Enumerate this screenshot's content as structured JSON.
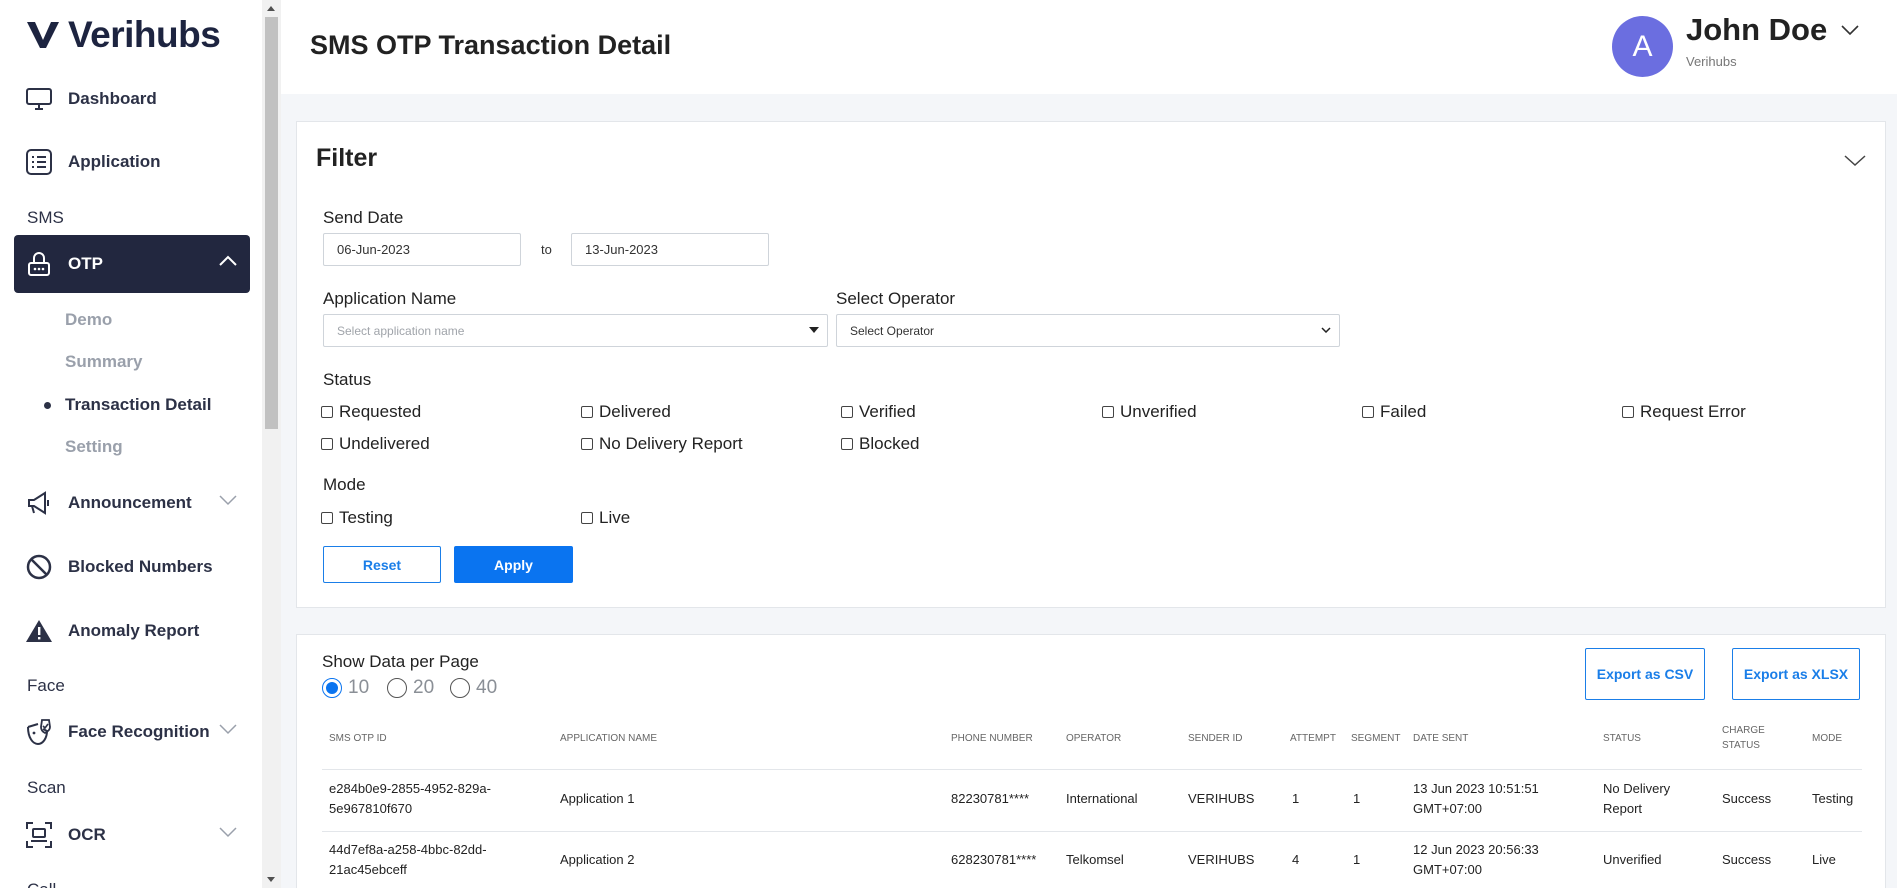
{
  "brand": {
    "name": "Verihubs",
    "accent": "#22273f",
    "primary": "#0a74f0"
  },
  "sidebar": {
    "dashboard": "Dashboard",
    "application": "Application",
    "sms_section": "SMS",
    "otp": "OTP",
    "otp_sub": [
      "Demo",
      "Summary",
      "Transaction Detail",
      "Setting"
    ],
    "announcement": "Announcement",
    "blocked_numbers": "Blocked Numbers",
    "anomaly_report": "Anomaly Report",
    "face_section": "Face",
    "face_recognition": "Face Recognition",
    "scan_section": "Scan",
    "ocr": "OCR",
    "next_section_partial": "Call"
  },
  "header": {
    "title": "SMS OTP Transaction Detail",
    "avatar_letter": "A",
    "user_name": "John Doe",
    "user_org": "Verihubs"
  },
  "filter": {
    "title": "Filter",
    "send_date_label": "Send Date",
    "date_from": "06-Jun-2023",
    "date_to_label": "to",
    "date_to": "13-Jun-2023",
    "app_name_label": "Application Name",
    "app_name_placeholder": "Select application name",
    "operator_label": "Select Operator",
    "operator_value": "Select Operator",
    "status_label": "Status",
    "statuses": [
      "Requested",
      "Delivered",
      "Verified",
      "Unverified",
      "Failed",
      "Request Error",
      "Undelivered",
      "No Delivery Report",
      "Blocked"
    ],
    "mode_label": "Mode",
    "modes": [
      "Testing",
      "Live"
    ],
    "reset": "Reset",
    "apply": "Apply"
  },
  "table": {
    "per_page_label": "Show Data per Page",
    "per_page_options": [
      "10",
      "20",
      "40"
    ],
    "per_page_selected": "10",
    "export_csv": "Export as CSV",
    "export_xlsx": "Export as XLSX",
    "headers": [
      "SMS OTP ID",
      "APPLICATION NAME",
      "PHONE NUMBER",
      "OPERATOR",
      "SENDER ID",
      "ATTEMPT",
      "SEGMENT",
      "DATE SENT",
      "STATUS",
      "CHARGE STATUS",
      "MODE"
    ],
    "rows": [
      {
        "id": "e284b0e9-2855-4952-829a-5e967810f670",
        "app": "Application 1",
        "phone": "82230781****",
        "operator": "International",
        "sender": "VERIHUBS",
        "attempt": "1",
        "segment": "1",
        "date": "13 Jun 2023 10:51:51 GMT+07:00",
        "status": "No Delivery Report",
        "charge": "Success",
        "mode": "Testing"
      },
      {
        "id": "44d7ef8a-a258-4bbc-82dd-21ac45ebceff",
        "app": "Application 2",
        "phone": "628230781****",
        "operator": "Telkomsel",
        "sender": "VERIHUBS",
        "attempt": "4",
        "segment": "1",
        "date": "12 Jun 2023 20:56:33 GMT+07:00",
        "status": "Unverified",
        "charge": "Success",
        "mode": "Live"
      }
    ]
  }
}
